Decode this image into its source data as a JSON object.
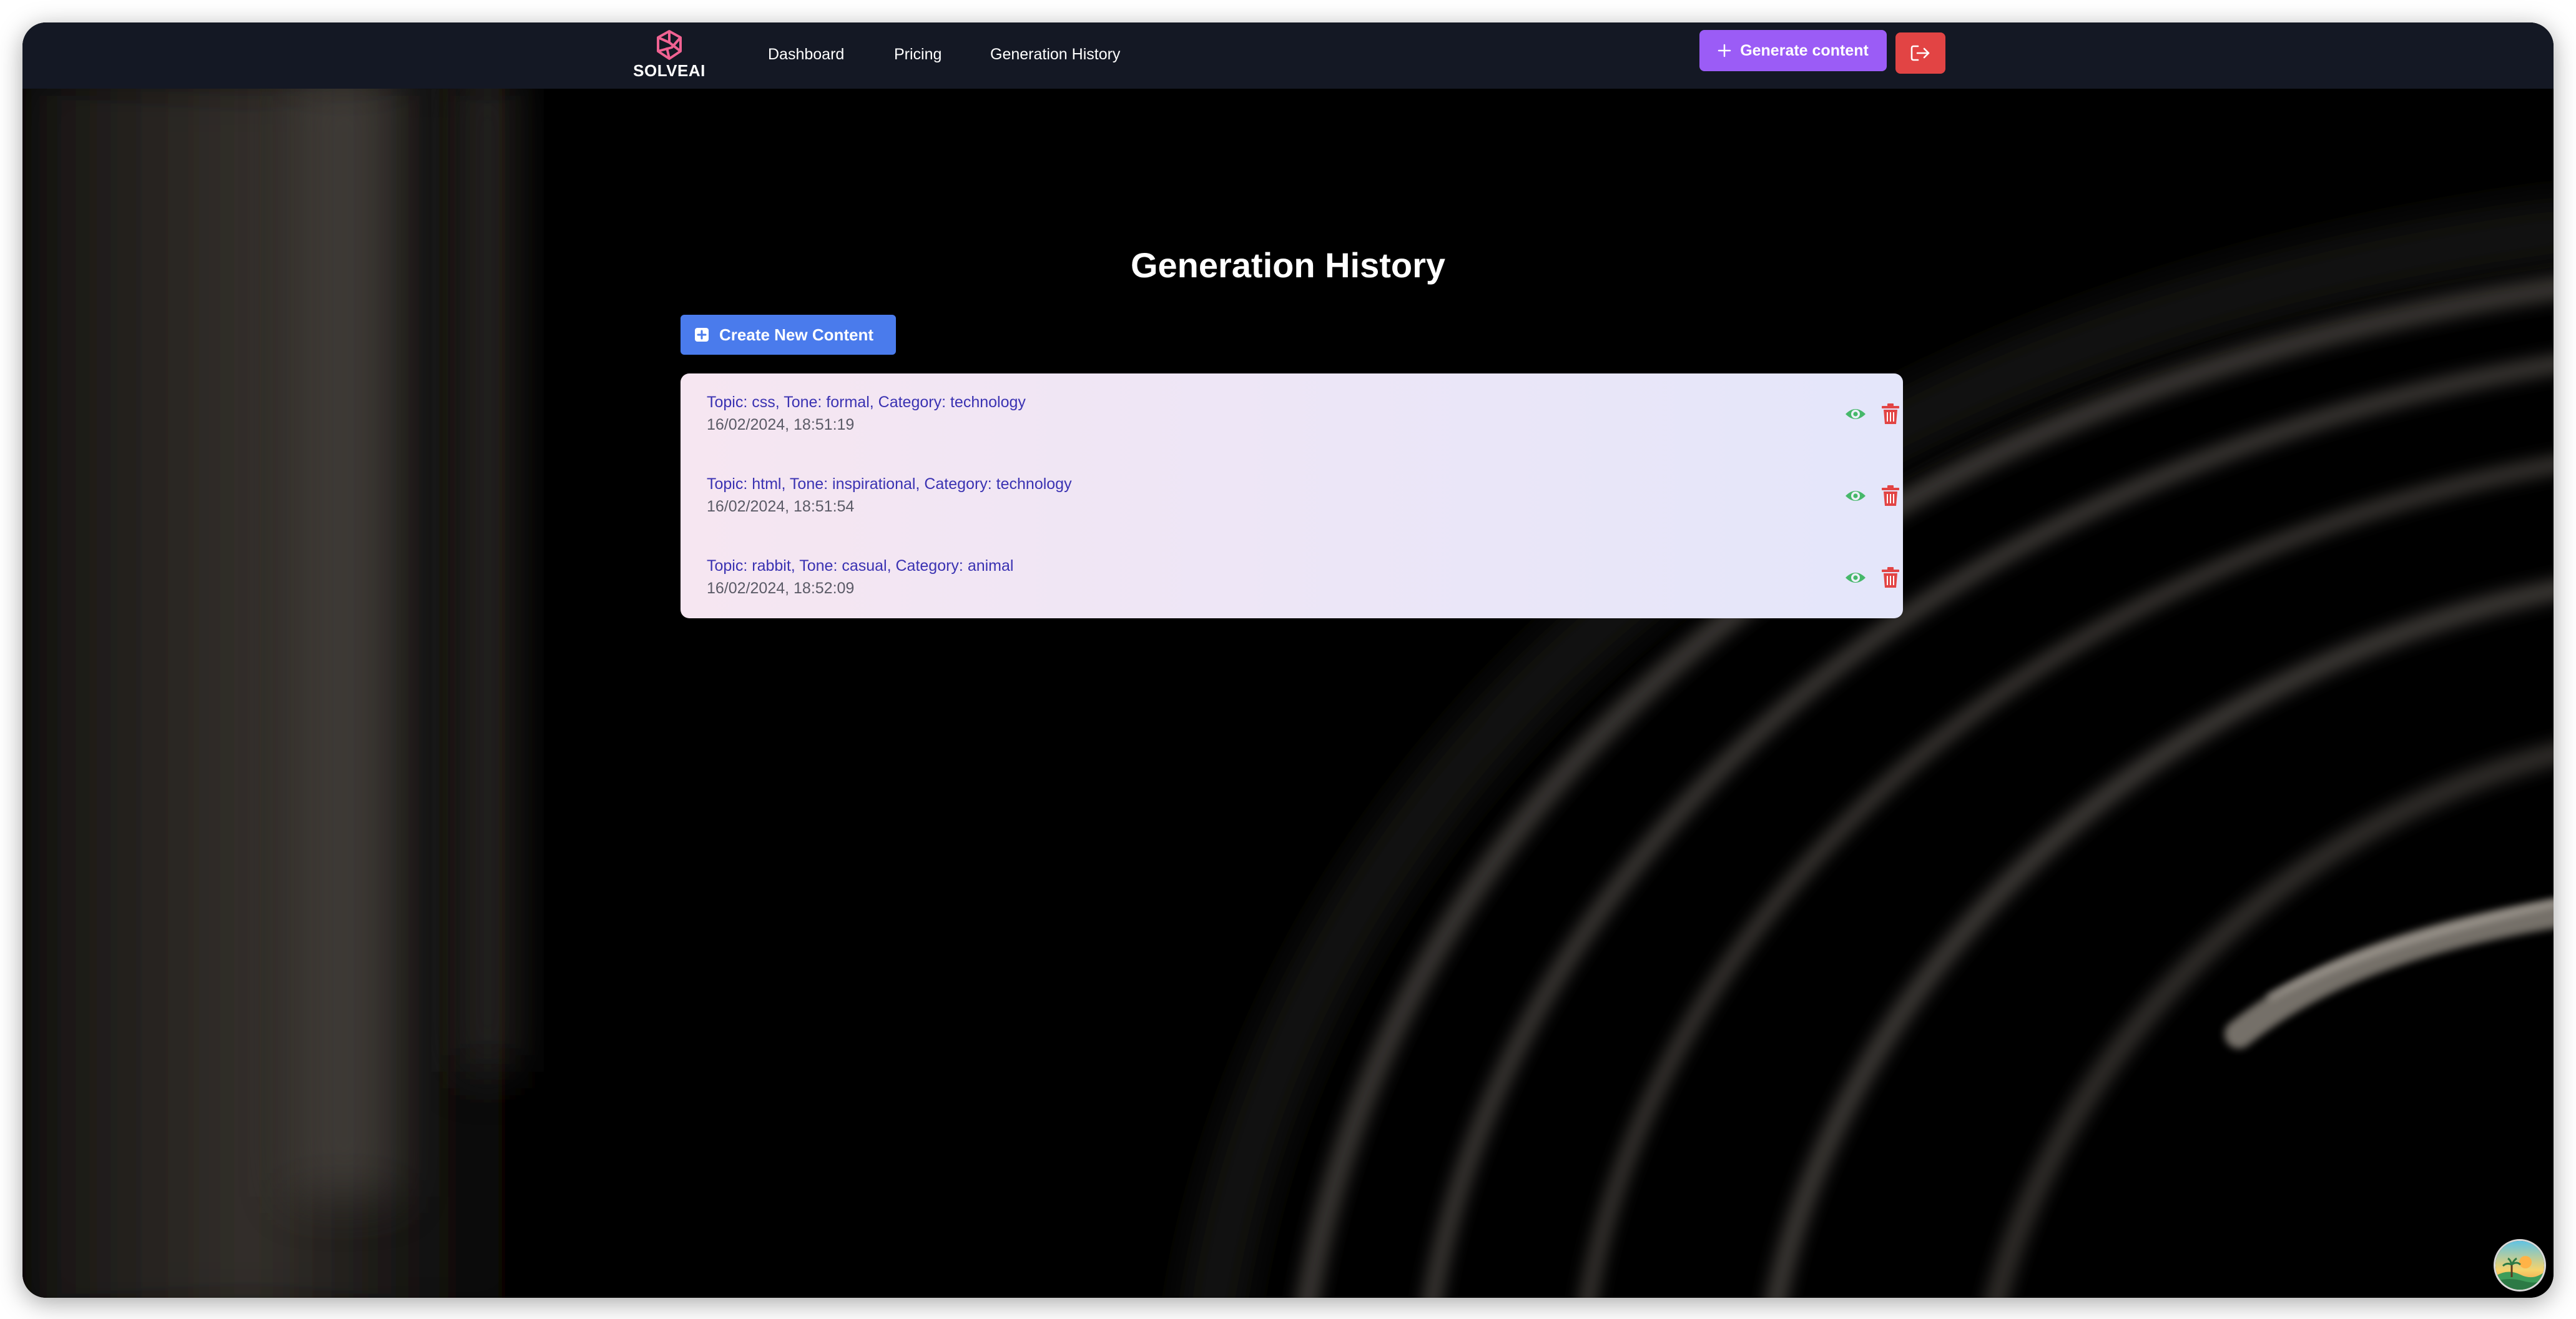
{
  "brand": {
    "name": "SOLVEAI",
    "accent": "#9b5cf6",
    "logo_color": "#f06292"
  },
  "nav": {
    "links": [
      {
        "label": "Dashboard"
      },
      {
        "label": "Pricing"
      },
      {
        "label": "Generation History"
      }
    ],
    "generate_label": "Generate content",
    "generate_icon": "plus-icon",
    "logout_icon": "logout-icon"
  },
  "main": {
    "title": "Generation History",
    "create_button_label": "Create New Content",
    "create_button_icon": "plus-square-icon",
    "items": [
      {
        "topic": "Topic: css, Tone: formal, Category: technology",
        "date": "16/02/2024, 18:51:19"
      },
      {
        "topic": "Topic: html, Tone: inspirational, Category: technology",
        "date": "16/02/2024, 18:51:54"
      },
      {
        "topic": "Topic: rabbit, Tone: casual, Category: animal",
        "date": "16/02/2024, 18:52:09"
      }
    ]
  },
  "colors": {
    "navbar_bg": "#141824",
    "create_button": "#4a7bec",
    "logout_button": "#e24444",
    "view_icon": "#46b86a",
    "delete_icon": "#e24444",
    "item_topic": "#3a32b2"
  }
}
